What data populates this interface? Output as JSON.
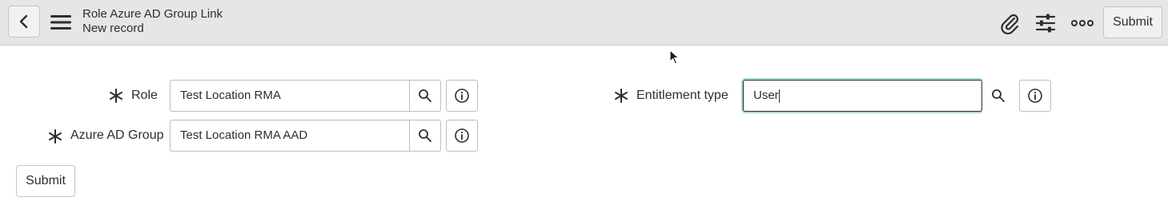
{
  "header": {
    "table_name": "Role Azure AD Group Link",
    "record_status": "New record",
    "submit_label": "Submit"
  },
  "form": {
    "role": {
      "label": "Role",
      "value": "Test Location RMA"
    },
    "azure_ad_group": {
      "label": "Azure AD Group",
      "value": "Test Location RMA AAD"
    },
    "entitlement_type": {
      "label": "Entitlement type",
      "value": "User"
    },
    "submit_label": "Submit"
  },
  "icons": {
    "back": "chevron-left-icon",
    "menu": "hamburger-menu-icon",
    "attachment": "paperclip-icon",
    "personalize": "sliders-icon",
    "more": "more-options-icon",
    "lookup": "search-icon",
    "info": "info-icon",
    "required": "required-asterisk-icon"
  },
  "colors": {
    "header_bg": "#e6e6e6",
    "focus_ring": "#9fd9cf"
  }
}
